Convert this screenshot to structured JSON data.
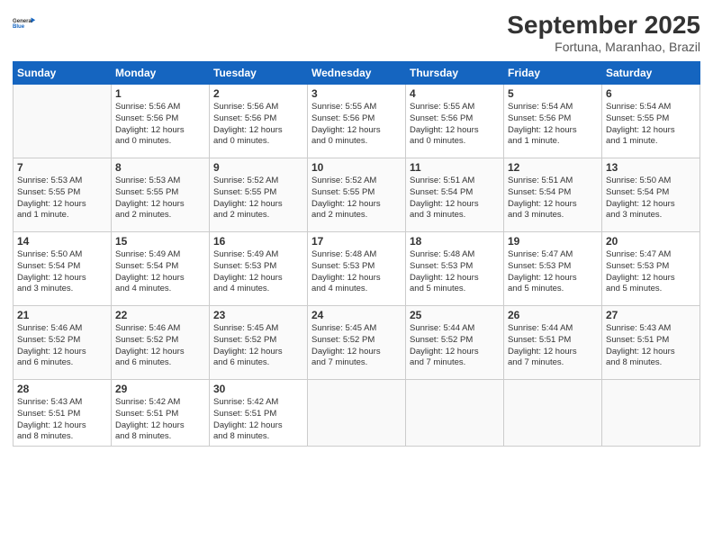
{
  "logo": {
    "text1": "General",
    "text2": "Blue"
  },
  "title": "September 2025",
  "subtitle": "Fortuna, Maranhao, Brazil",
  "days_of_week": [
    "Sunday",
    "Monday",
    "Tuesday",
    "Wednesday",
    "Thursday",
    "Friday",
    "Saturday"
  ],
  "rows": [
    [
      {
        "num": "",
        "info": ""
      },
      {
        "num": "1",
        "info": "Sunrise: 5:56 AM\nSunset: 5:56 PM\nDaylight: 12 hours\nand 0 minutes."
      },
      {
        "num": "2",
        "info": "Sunrise: 5:56 AM\nSunset: 5:56 PM\nDaylight: 12 hours\nand 0 minutes."
      },
      {
        "num": "3",
        "info": "Sunrise: 5:55 AM\nSunset: 5:56 PM\nDaylight: 12 hours\nand 0 minutes."
      },
      {
        "num": "4",
        "info": "Sunrise: 5:55 AM\nSunset: 5:56 PM\nDaylight: 12 hours\nand 0 minutes."
      },
      {
        "num": "5",
        "info": "Sunrise: 5:54 AM\nSunset: 5:56 PM\nDaylight: 12 hours\nand 1 minute."
      },
      {
        "num": "6",
        "info": "Sunrise: 5:54 AM\nSunset: 5:55 PM\nDaylight: 12 hours\nand 1 minute."
      }
    ],
    [
      {
        "num": "7",
        "info": "Sunrise: 5:53 AM\nSunset: 5:55 PM\nDaylight: 12 hours\nand 1 minute."
      },
      {
        "num": "8",
        "info": "Sunrise: 5:53 AM\nSunset: 5:55 PM\nDaylight: 12 hours\nand 2 minutes."
      },
      {
        "num": "9",
        "info": "Sunrise: 5:52 AM\nSunset: 5:55 PM\nDaylight: 12 hours\nand 2 minutes."
      },
      {
        "num": "10",
        "info": "Sunrise: 5:52 AM\nSunset: 5:55 PM\nDaylight: 12 hours\nand 2 minutes."
      },
      {
        "num": "11",
        "info": "Sunrise: 5:51 AM\nSunset: 5:54 PM\nDaylight: 12 hours\nand 3 minutes."
      },
      {
        "num": "12",
        "info": "Sunrise: 5:51 AM\nSunset: 5:54 PM\nDaylight: 12 hours\nand 3 minutes."
      },
      {
        "num": "13",
        "info": "Sunrise: 5:50 AM\nSunset: 5:54 PM\nDaylight: 12 hours\nand 3 minutes."
      }
    ],
    [
      {
        "num": "14",
        "info": "Sunrise: 5:50 AM\nSunset: 5:54 PM\nDaylight: 12 hours\nand 3 minutes."
      },
      {
        "num": "15",
        "info": "Sunrise: 5:49 AM\nSunset: 5:54 PM\nDaylight: 12 hours\nand 4 minutes."
      },
      {
        "num": "16",
        "info": "Sunrise: 5:49 AM\nSunset: 5:53 PM\nDaylight: 12 hours\nand 4 minutes."
      },
      {
        "num": "17",
        "info": "Sunrise: 5:48 AM\nSunset: 5:53 PM\nDaylight: 12 hours\nand 4 minutes."
      },
      {
        "num": "18",
        "info": "Sunrise: 5:48 AM\nSunset: 5:53 PM\nDaylight: 12 hours\nand 5 minutes."
      },
      {
        "num": "19",
        "info": "Sunrise: 5:47 AM\nSunset: 5:53 PM\nDaylight: 12 hours\nand 5 minutes."
      },
      {
        "num": "20",
        "info": "Sunrise: 5:47 AM\nSunset: 5:53 PM\nDaylight: 12 hours\nand 5 minutes."
      }
    ],
    [
      {
        "num": "21",
        "info": "Sunrise: 5:46 AM\nSunset: 5:52 PM\nDaylight: 12 hours\nand 6 minutes."
      },
      {
        "num": "22",
        "info": "Sunrise: 5:46 AM\nSunset: 5:52 PM\nDaylight: 12 hours\nand 6 minutes."
      },
      {
        "num": "23",
        "info": "Sunrise: 5:45 AM\nSunset: 5:52 PM\nDaylight: 12 hours\nand 6 minutes."
      },
      {
        "num": "24",
        "info": "Sunrise: 5:45 AM\nSunset: 5:52 PM\nDaylight: 12 hours\nand 7 minutes."
      },
      {
        "num": "25",
        "info": "Sunrise: 5:44 AM\nSunset: 5:52 PM\nDaylight: 12 hours\nand 7 minutes."
      },
      {
        "num": "26",
        "info": "Sunrise: 5:44 AM\nSunset: 5:51 PM\nDaylight: 12 hours\nand 7 minutes."
      },
      {
        "num": "27",
        "info": "Sunrise: 5:43 AM\nSunset: 5:51 PM\nDaylight: 12 hours\nand 8 minutes."
      }
    ],
    [
      {
        "num": "28",
        "info": "Sunrise: 5:43 AM\nSunset: 5:51 PM\nDaylight: 12 hours\nand 8 minutes."
      },
      {
        "num": "29",
        "info": "Sunrise: 5:42 AM\nSunset: 5:51 PM\nDaylight: 12 hours\nand 8 minutes."
      },
      {
        "num": "30",
        "info": "Sunrise: 5:42 AM\nSunset: 5:51 PM\nDaylight: 12 hours\nand 8 minutes."
      },
      {
        "num": "",
        "info": ""
      },
      {
        "num": "",
        "info": ""
      },
      {
        "num": "",
        "info": ""
      },
      {
        "num": "",
        "info": ""
      }
    ]
  ]
}
